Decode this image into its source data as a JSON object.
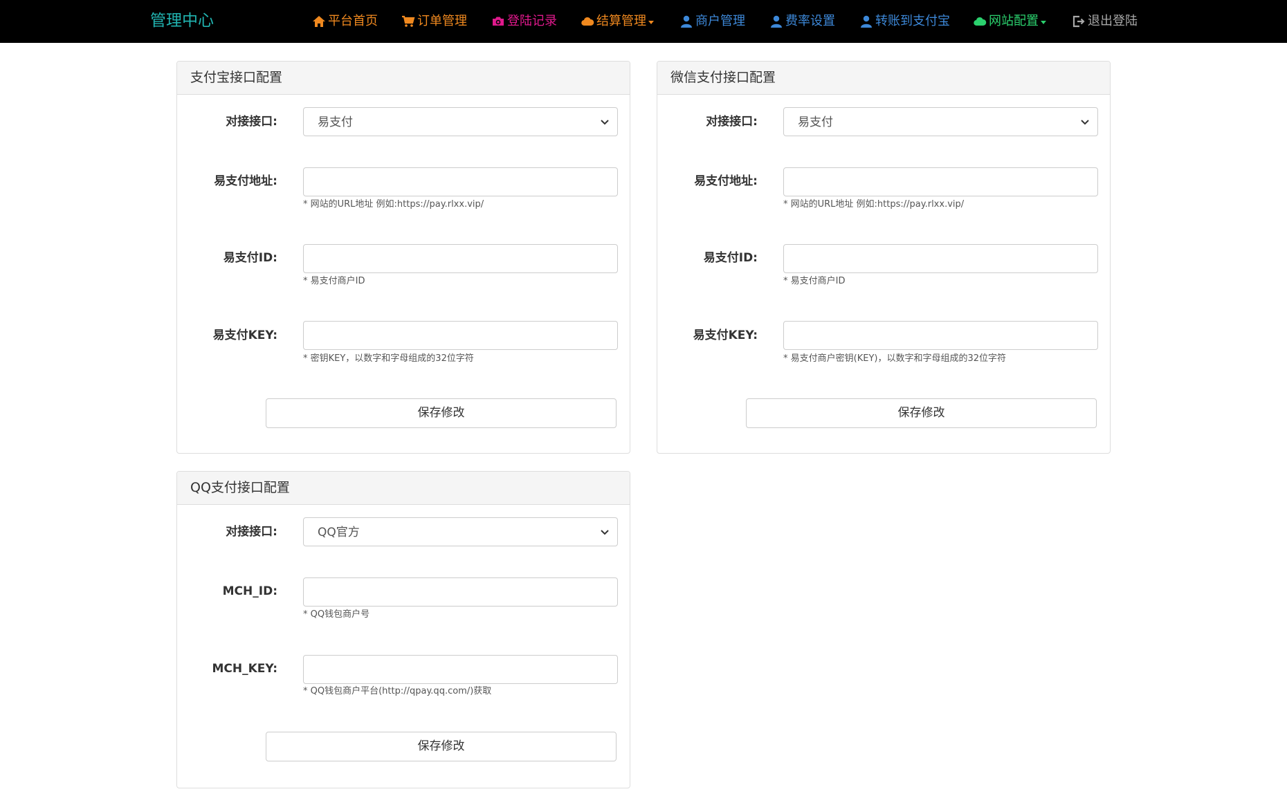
{
  "nav": {
    "brand": "管理中心",
    "items": [
      {
        "label": "平台首页",
        "icon": "home-icon",
        "color": "#f0891f"
      },
      {
        "label": "订单管理",
        "icon": "cart-icon",
        "color": "#f0891f"
      },
      {
        "label": "登陆记录",
        "icon": "camera-icon",
        "color": "#e0198c"
      },
      {
        "label": "结算管理",
        "icon": "cloud-icon",
        "color": "#f0891f"
      },
      {
        "label": "商户管理",
        "icon": "user-icon",
        "color": "#3d88d8"
      },
      {
        "label": "费率设置",
        "icon": "user-icon",
        "color": "#3d88d8"
      },
      {
        "label": "转账到支付宝",
        "icon": "user-icon",
        "color": "#3d88d8"
      },
      {
        "label": "网站配置",
        "icon": "cloud-icon",
        "color": "#2bd16e"
      },
      {
        "label": "退出登陆",
        "icon": "logout-icon",
        "color": "#a8a8a8"
      }
    ]
  },
  "alipay": {
    "title": "支付宝接口配置",
    "interface_label": "对接接口:",
    "interface_value": "易支付",
    "url_label": "易支付地址:",
    "url_value": "",
    "url_help": "* 网站的URL地址 例如:https://pay.rlxx.vip/",
    "id_label": "易支付ID:",
    "id_value": "",
    "id_help": "* 易支付商户ID",
    "key_label": "易支付KEY:",
    "key_value": "",
    "key_help": "* 密钥KEY，以数字和字母组成的32位字符",
    "save_label": "保存修改"
  },
  "wechat": {
    "title": "微信支付接口配置",
    "interface_label": "对接接口:",
    "interface_value": "易支付",
    "url_label": "易支付地址:",
    "url_value": "",
    "url_help": "* 网站的URL地址 例如:https://pay.rlxx.vip/",
    "id_label": "易支付ID:",
    "id_value": "",
    "id_help": "* 易支付商户ID",
    "key_label": "易支付KEY:",
    "key_value": "",
    "key_help": "* 易支付商户密钥(KEY)，以数字和字母组成的32位字符",
    "save_label": "保存修改"
  },
  "qq": {
    "title": "QQ支付接口配置",
    "interface_label": "对接接口:",
    "interface_value": "QQ官方",
    "mch_id_label": "MCH_ID:",
    "mch_id_value": "",
    "mch_id_help": "* QQ钱包商户号",
    "mch_key_label": "MCH_KEY:",
    "mch_key_value": "",
    "mch_key_help": "* QQ钱包商户平台(http://qpay.qq.com/)获取",
    "save_label": "保存修改"
  }
}
